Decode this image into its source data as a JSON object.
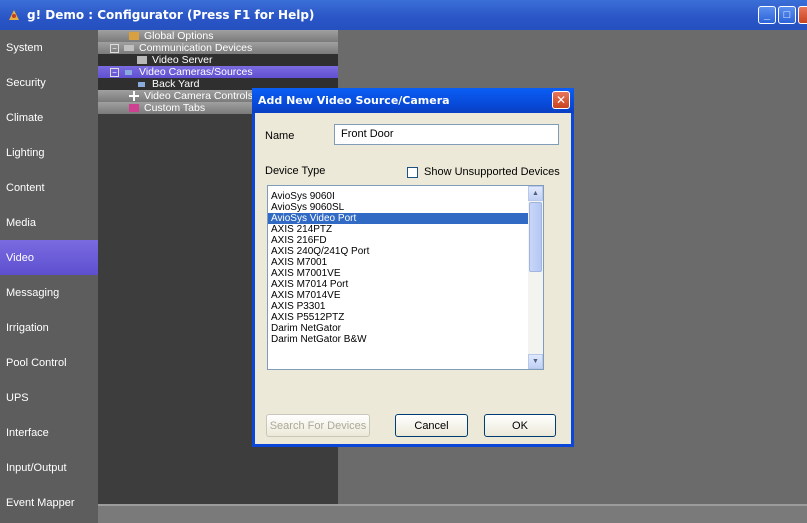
{
  "window": {
    "title": "g! Demo : Configurator   (Press F1 for Help)",
    "minimize": "_",
    "maximize": "□"
  },
  "nav": {
    "items": [
      "System",
      "Security",
      "Climate",
      "Lighting",
      "Content",
      "Media",
      "Video",
      "Messaging",
      "Irrigation",
      "Pool Control",
      "UPS",
      "Interface",
      "Input/Output",
      "Event Mapper"
    ],
    "active": "Video"
  },
  "tree": {
    "rows": [
      {
        "label": "Global Options",
        "type": "hdr",
        "icon": "wrench-icon"
      },
      {
        "label": "Communication Devices",
        "type": "hdr",
        "icon": "network-icon",
        "expander": "−"
      },
      {
        "label": "Video Server",
        "type": "sub",
        "icon": "server-icon"
      },
      {
        "label": "Video Cameras/Sources",
        "type": "sel",
        "icon": "camera-icon",
        "expander": "−"
      },
      {
        "label": "Back Yard",
        "type": "sub",
        "icon": "camera-icon"
      },
      {
        "label": "Video Camera Controls",
        "type": "hdr",
        "icon": "joystick-icon"
      },
      {
        "label": "Custom Tabs",
        "type": "hdr",
        "icon": "tabs-icon"
      }
    ]
  },
  "dialog": {
    "title": "Add New Video Source/Camera",
    "close": "✕",
    "name_label": "Name",
    "name_value": "Front Door",
    "device_type_label": "Device Type",
    "show_unsupported_label": "Show Unsupported Devices",
    "devices": [
      "AvioSys 9060I",
      "AvioSys 9060SL",
      "AvioSys Video Port",
      "AXIS 214PTZ",
      "AXIS 216FD",
      "AXIS 240Q/241Q Port",
      "AXIS M7001",
      "AXIS M7001VE",
      "AXIS M7014 Port",
      "AXIS M7014VE",
      "AXIS P3301",
      "AXIS P5512PTZ",
      "Darim NetGator",
      "Darim NetGator B&W"
    ],
    "selected_device": "AvioSys Video Port",
    "scroll_up": "▲",
    "scroll_down": "▼",
    "search_button": "Search For Devices",
    "cancel_button": "Cancel",
    "ok_button": "OK"
  }
}
